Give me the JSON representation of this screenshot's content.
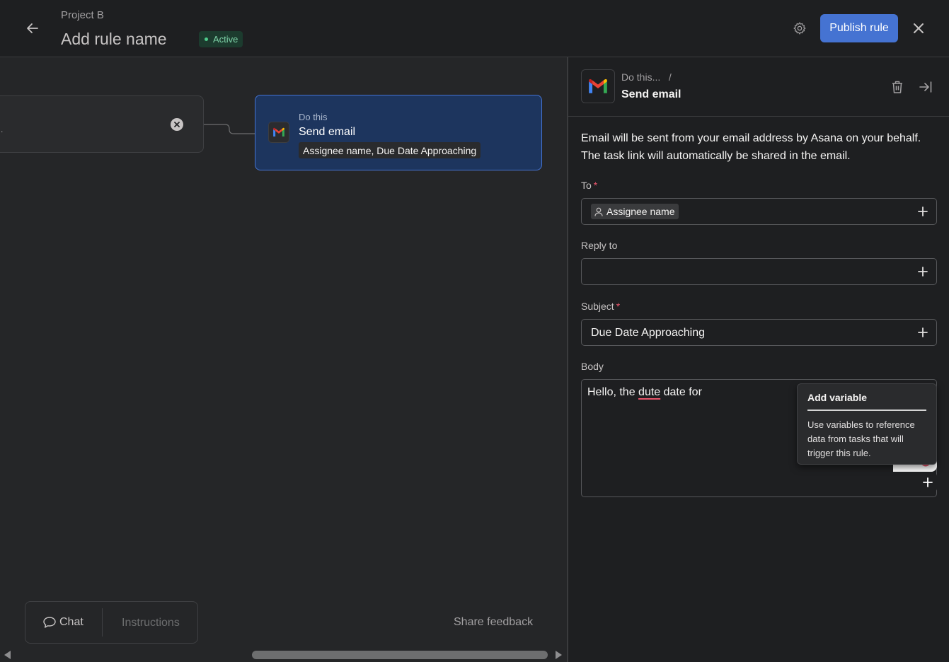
{
  "header": {
    "project_name": "Project B",
    "rule_name": "Add rule name",
    "status": "Active",
    "publish_label": "Publish rule"
  },
  "canvas": {
    "trigger_text": ".",
    "action_card": {
      "eyebrow": "Do this",
      "title": "Send email",
      "chip": "Assignee name, Due Date Approaching"
    },
    "bottom_bar": {
      "chat_label": "Chat",
      "instructions_label": "Instructions"
    },
    "share_feedback": "Share feedback"
  },
  "panel": {
    "breadcrumb": "Do this...   /",
    "title": "Send email",
    "description": "Email will be sent from your email address by Asana on your behalf. The task link will automatically be shared in the email.",
    "to": {
      "label": "To",
      "required": "*",
      "chip": "Assignee name"
    },
    "reply_to": {
      "label": "Reply to",
      "value": ""
    },
    "subject": {
      "label": "Subject",
      "required": "*",
      "value": "Due Date Approaching"
    },
    "body": {
      "label": "Body",
      "text_before": "Hello, the ",
      "misspelled_word": "dute",
      "text_after": " date for"
    },
    "tooltip": {
      "title": "Add variable",
      "body": "Use variables to reference data from tasks that will trigger this rule."
    }
  },
  "colors": {
    "accent": "#4573d2",
    "active_green": "#4ecb8b",
    "required": "#e8556b"
  },
  "icons": [
    "back-arrow-icon",
    "gear-icon",
    "close-icon",
    "gmail-icon",
    "trash-icon",
    "collapse-panel-icon",
    "plus-icon",
    "person-icon",
    "chat-bubble-icon",
    "remove-circle-icon"
  ]
}
